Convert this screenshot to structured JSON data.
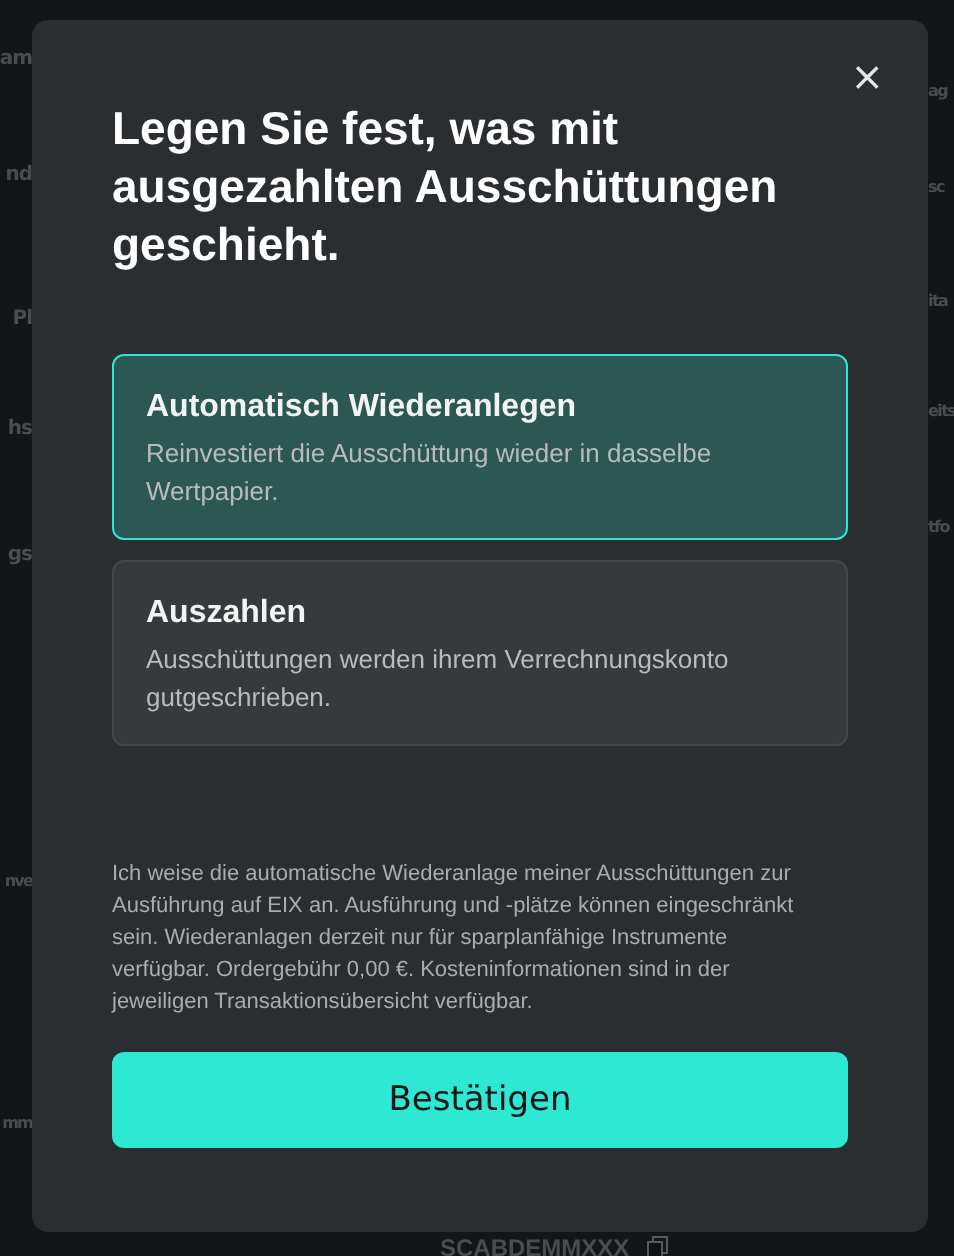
{
  "background": {
    "left_fragments": [
      "am",
      "nd",
      "Pl",
      "hs",
      "gs",
      "nve",
      "mm"
    ],
    "right_fragments": [
      "ag",
      "sc",
      "ita",
      "eits",
      "tfo"
    ],
    "bottom_code": "SCABDEMMXXX"
  },
  "dialog": {
    "close": "×",
    "title": "Legen Sie fest, was mit ausgezahlten Ausschüttungen geschieht.",
    "options": [
      {
        "title": "Automatisch Wiederanlegen",
        "description": "Reinvestiert die Ausschüttung wieder in dasselbe Wertpapier.",
        "selected": true
      },
      {
        "title": "Auszahlen",
        "description": "Ausschüttungen werden ihrem Verrechnungskonto gutgeschrieben.",
        "selected": false
      }
    ],
    "disclaimer": "Ich weise die automatische Wiederanlage meiner Ausschüttungen zur Ausführung auf EIX an. Ausführung und -plätze können eingeschränkt sein. Wiederanlagen derzeit nur für sparplanfähige Instrumente verfügbar. Ordergebühr 0,00 €. Kosteninformationen sind in der jeweiligen Transaktionsübersicht verfügbar.",
    "confirm": "Bestätigen"
  }
}
